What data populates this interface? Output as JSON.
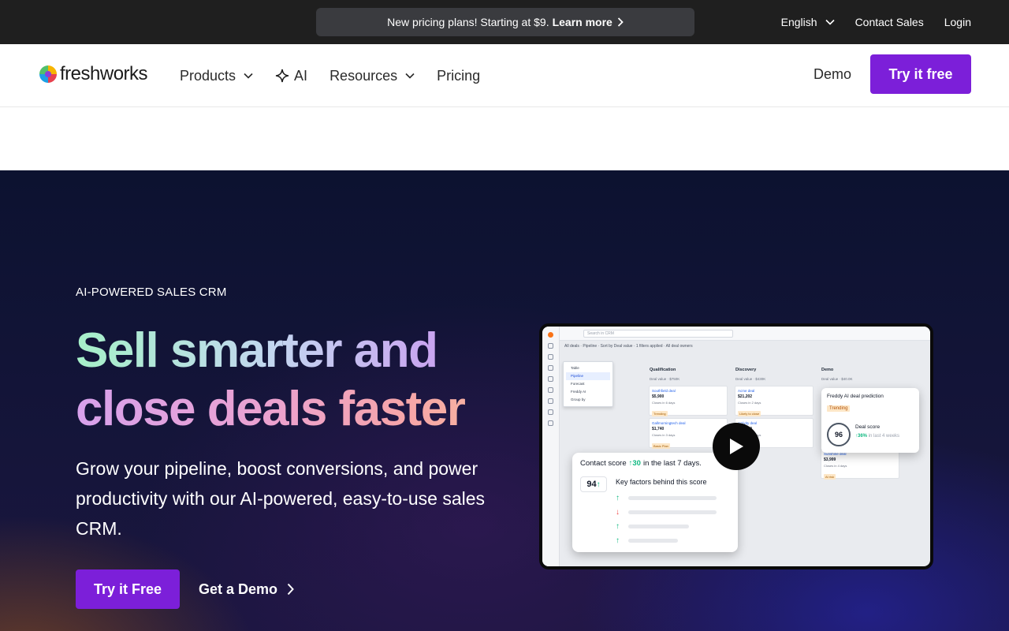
{
  "announcement": {
    "text": "New pricing plans! Starting at $9.",
    "link_label": "Learn more"
  },
  "utility_nav": {
    "language": "English",
    "contact_sales": "Contact Sales",
    "login": "Login"
  },
  "brand": {
    "name": "freshworks"
  },
  "main_nav": {
    "products": "Products",
    "ai": "AI",
    "resources": "Resources",
    "pricing": "Pricing",
    "demo": "Demo",
    "cta": "Try it free"
  },
  "hero": {
    "eyebrow": "AI-POWERED SALES CRM",
    "headline_line1": "Sell smarter and",
    "headline_line2": "close deals faster",
    "subtext": "Grow your pipeline, boost conversions, and power productivity with our AI-powered, easy-to-use sales CRM.",
    "cta_primary": "Try it Free",
    "cta_secondary": "Get a Demo"
  },
  "product_preview": {
    "search_placeholder": "Search in CRM",
    "subbar_text": "All deals · Pipeline · Sort by Deal value · 1 filters applied · All deal owners",
    "dropdown_items": [
      "Table",
      "Pipeline",
      "Forecast",
      "Freddy AI",
      "Group by"
    ],
    "columns": [
      {
        "name": "Qualification",
        "sub": "Deal value · $750K",
        "cards": [
          {
            "title": "Southfield deal",
            "value": "$5,900",
            "sub": "Closes in 6 days",
            "tag": "Trending"
          },
          {
            "title": "Gallmorningtech deal",
            "value": "$1,740",
            "sub": "Closes in 3 days",
            "tag": "Basic Plan"
          }
        ]
      },
      {
        "name": "Discovery",
        "sub": "Deal value · $430K",
        "cards": [
          {
            "title": "Acme deal",
            "value": "$21,202",
            "sub": "Closes in 2 days",
            "tag": "Likely to close"
          },
          {
            "title": "Activity deal",
            "value": "$40,000",
            "sub": "Closes in 5 days",
            "tag": "Basic Plan"
          }
        ]
      },
      {
        "name": "Demo",
        "sub": "Deal value · $40.0K",
        "cards": [
          {
            "title": "Sunshine deal",
            "value": "$3,999",
            "sub": "Closes in 4 days",
            "tag": "At risk"
          }
        ]
      }
    ],
    "contact_score": {
      "label": "Contact score",
      "change": "30",
      "period": "in the last 7 days.",
      "value": "94",
      "factors_title": "Key factors behind this score",
      "factor_directions": [
        "up",
        "down",
        "up",
        "up"
      ],
      "factor_bar_fractions": [
        0.8,
        0.8,
        0.55,
        0.45
      ]
    },
    "deal_prediction": {
      "title": "Freddy AI deal prediction",
      "badge": "Trending",
      "score": "96",
      "score_label": "Deal score",
      "change": "36%",
      "period": "in last 4 weeks"
    }
  },
  "colors": {
    "brand_purple": "#7c1fd9",
    "topbar_bg": "#1f1f1f",
    "hero_bg": "#0c1230"
  }
}
